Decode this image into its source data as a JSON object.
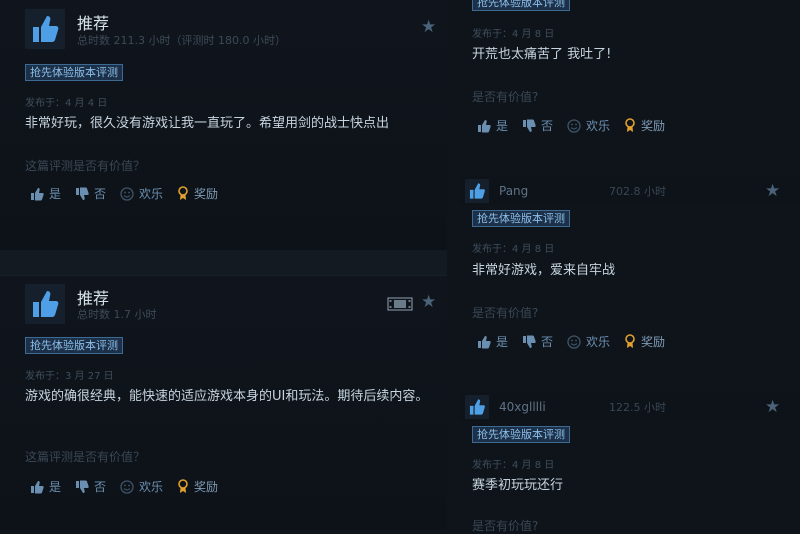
{
  "left": {
    "reviews": [
      {
        "recommend": "推荐",
        "hours": "总时数 211.3 小时（评测时 180.0 小时）",
        "tag": "抢先体验版本评测",
        "posted": "发布于：4 月 4 日",
        "text": "非常好玩，很久没有游戏让我一直玩了。希望用剑的战士快点出",
        "helpful": "这篇评测是否有价值？"
      },
      {
        "recommend": "推荐",
        "hours": "总时数 1.7 小时",
        "tag": "抢先体验版本评测",
        "posted": "发布于：3 月 27 日",
        "text": "游戏的确很经典，能快速的适应游戏本身的UI和玩法。期待后续内容。",
        "helpful": "这篇评测是否有价值？"
      }
    ]
  },
  "right": {
    "reviews": [
      {
        "tag": "抢先体验版本评测",
        "posted": "发布于：4 月 8 日",
        "text": "开荒也太痛苦了 我吐了!",
        "helpful": "是否有价值?"
      },
      {
        "user": "Pang",
        "hours": "702.8 小时",
        "tag": "抢先体验版本评测",
        "posted": "发布于：4 月 8 日",
        "text": "非常好游戏，爱来自牢战",
        "helpful": "是否有价值?"
      },
      {
        "user": "40xglllli",
        "hours": "122.5 小时",
        "tag": "抢先体验版本评测",
        "posted": "发布于：4 月 8 日",
        "text": "赛季初玩玩还行",
        "helpful": "是否有价值?"
      }
    ]
  },
  "votes": {
    "yes": "是",
    "no": "否",
    "funny": "欢乐",
    "award": "奖励"
  },
  "icons": {
    "recommend": "thumbs-up-icon",
    "star": "star-icon",
    "film": "film-icon",
    "vote_yes": "thumbs-up-icon",
    "vote_no": "thumbs-down-icon",
    "vote_funny": "smiley-icon",
    "vote_award": "award-icon"
  },
  "colors": {
    "background": "#0f141b",
    "accent": "#3c6a93",
    "tag_text": "#8dbfe9",
    "vote_text": "#6b8fb0"
  }
}
